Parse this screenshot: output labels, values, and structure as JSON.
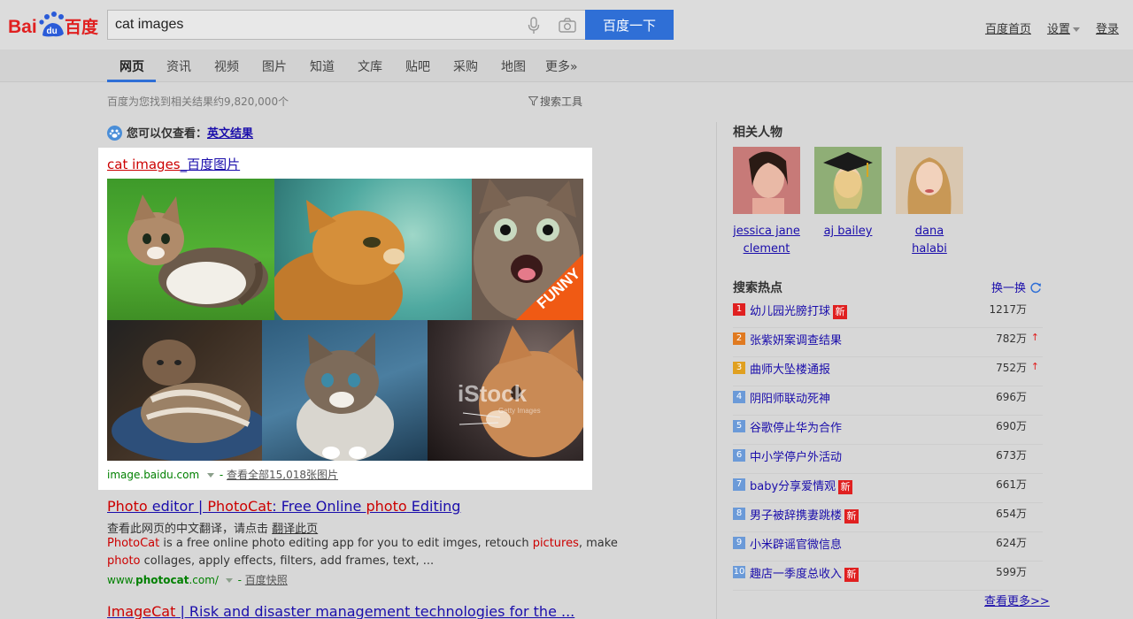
{
  "header": {
    "logo_text_latin": "Bai",
    "logo_text_du": "du",
    "logo_text_cn": "百度",
    "search_value": "cat images",
    "search_button": "百度一下",
    "links": [
      "百度首页",
      "设置",
      "登录"
    ]
  },
  "tabs": [
    "网页",
    "资讯",
    "视频",
    "图片",
    "知道",
    "文库",
    "贴吧",
    "采购",
    "地图",
    "更多»"
  ],
  "result_count": "百度为您找到相关结果约9,820,000个",
  "search_tools": "搜索工具",
  "hint": {
    "label": "您可以仅查看：",
    "link": "英文结果"
  },
  "image_card": {
    "title_red": "cat images",
    "title_rest": "_百度图片",
    "overlay_funny": "FUNNY",
    "watermark": "iStock",
    "watermark_sub": "Getty Images",
    "source": "image.baidu.com",
    "separator": "-",
    "view_all": "查看全部15,018张图片"
  },
  "results": [
    {
      "title_parts": [
        {
          "t": "Photo",
          "red": true
        },
        {
          "t": " editor | ",
          "red": false
        },
        {
          "t": "PhotoCat",
          "red": true
        },
        {
          "t": ": Free Online ",
          "red": false
        },
        {
          "t": "photo",
          "red": true
        },
        {
          "t": " Editing",
          "red": false
        }
      ],
      "translate_prompt": "查看此网页的中文翻译，请点击",
      "translate_link": "翻译此页",
      "snippet1_parts": [
        {
          "t": "PhotoCat",
          "red": true
        },
        {
          "t": " is a free online photo editing app for you to edit imges, retouch ",
          "red": false
        },
        {
          "t": "pictures",
          "red": true
        },
        {
          "t": ", make",
          "red": false
        }
      ],
      "snippet2_parts": [
        {
          "t": "photo",
          "red": true
        },
        {
          "t": " collages, apply effects, filters, add frames, text, ...",
          "red": false
        }
      ],
      "url_prefix": "www.",
      "url_bold": "photocat",
      "url_suffix": ".com/",
      "separator": "-",
      "snapshot": "百度快照"
    },
    {
      "title_parts": [
        {
          "t": "ImageCat",
          "red": true
        },
        {
          "t": " | Risk and disaster management technologies for the ...",
          "red": false
        }
      ]
    }
  ],
  "sidebar": {
    "people_title": "相关人物",
    "people": [
      {
        "name_line1": "jessica jane",
        "name_line2": "clement"
      },
      {
        "name_line1": "aj bailey",
        "name_line2": ""
      },
      {
        "name_line1": "dana halabi",
        "name_line2": ""
      }
    ],
    "hot_title": "搜索热点",
    "swap_label": "换一换",
    "hot_items": [
      {
        "rank": "1",
        "text": "幼儿园光膀打球",
        "badge": "新",
        "count": "1217万",
        "up": ""
      },
      {
        "rank": "2",
        "text": "张紫妍案调查结果",
        "badge": "",
        "count": "782万",
        "up": "↑"
      },
      {
        "rank": "3",
        "text": "曲师大坠楼通报",
        "badge": "",
        "count": "752万",
        "up": "↑"
      },
      {
        "rank": "4",
        "text": "阴阳师联动死神",
        "badge": "",
        "count": "696万",
        "up": ""
      },
      {
        "rank": "5",
        "text": "谷歌停止华为合作",
        "badge": "",
        "count": "690万",
        "up": ""
      },
      {
        "rank": "6",
        "text": "中小学停户外活动",
        "badge": "",
        "count": "673万",
        "up": ""
      },
      {
        "rank": "7",
        "text": "baby分享爱情观",
        "badge": "新",
        "count": "661万",
        "up": ""
      },
      {
        "rank": "8",
        "text": "男子被辞携妻跳楼",
        "badge": "新",
        "count": "654万",
        "up": ""
      },
      {
        "rank": "9",
        "text": "小米辟谣官微信息",
        "badge": "",
        "count": "624万",
        "up": ""
      },
      {
        "rank": "10",
        "text": "趣店一季度总收入",
        "badge": "新",
        "count": "599万",
        "up": ""
      }
    ],
    "more": "查看更多>>"
  },
  "colors": {
    "accent": "#2f6fd6",
    "rank_top": [
      "#e02020",
      "#e07a20",
      "#e0a020"
    ],
    "rank_other": "#6b9ad8"
  }
}
